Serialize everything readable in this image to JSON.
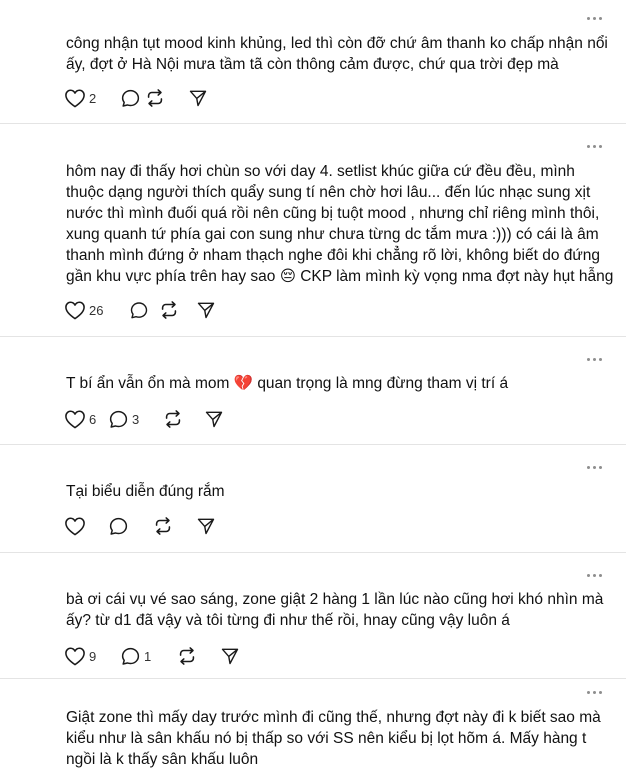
{
  "posts": [
    {
      "lines": [
        "công nhận tụt mood kinh khủng, led thì còn đỡ chứ âm thanh ko chấp nhận nổi",
        "ấy, đợt ở Hà Nội mưa tầm tã còn thông cảm được, chứ qua trời đẹp mà"
      ],
      "likes": "2",
      "replies": ""
    },
    {
      "lines": [
        "hôm nay đi thấy hơi chùn so với day 4. setlist khúc giữa cứ đều đều, mình",
        "thuộc dạng người thích quẩy sung tí nên chờ hơi lâu... đến lúc nhạc sung xịt",
        "nước thì mình đuối quá rồi nên cũng bị tuột mood , nhưng chỉ riêng mình thôi,",
        "xung quanh tứ phía gai con sung như chưa từng dc tắm mưa :))) có cái là âm",
        "thanh mình đứng ở nham thạch nghe đôi khi chẳng rõ lời, không biết do đứng",
        "gần khu vực phía trên hay sao 😔 CKP làm mình kỳ vọng nma đợt này hụt hẫng"
      ],
      "likes": "26",
      "replies": ""
    },
    {
      "lines": [
        "T bí ẩn vẫn ổn mà mom 💔 quan trọng là mng đừng tham vị trí á"
      ],
      "likes": "6",
      "replies": "3"
    },
    {
      "lines": [
        "Tại biểu diễn đúng rắm"
      ],
      "likes": "",
      "replies": ""
    },
    {
      "lines": [
        "bà ơi cái vụ vé sao sáng, zone giật 2 hàng 1 lần lúc nào cũng hơi khó nhìn mà",
        "ấy? từ d1 đã vậy và tôi từng đi như thế rồi, hnay cũng vậy luôn á"
      ],
      "likes": "9",
      "replies": "1"
    },
    {
      "lines": [
        "Giật zone thì mấy day trước mình đi cũng thế, nhưng đợt này đi k biết sao mà",
        "kiểu như là sân khấu nó bị thấp so với SS nên kiểu bị lọt hõm á. Mấy hàng t",
        "ngồi là k thấy sân khấu luôn"
      ],
      "likes": "",
      "replies": ""
    }
  ]
}
